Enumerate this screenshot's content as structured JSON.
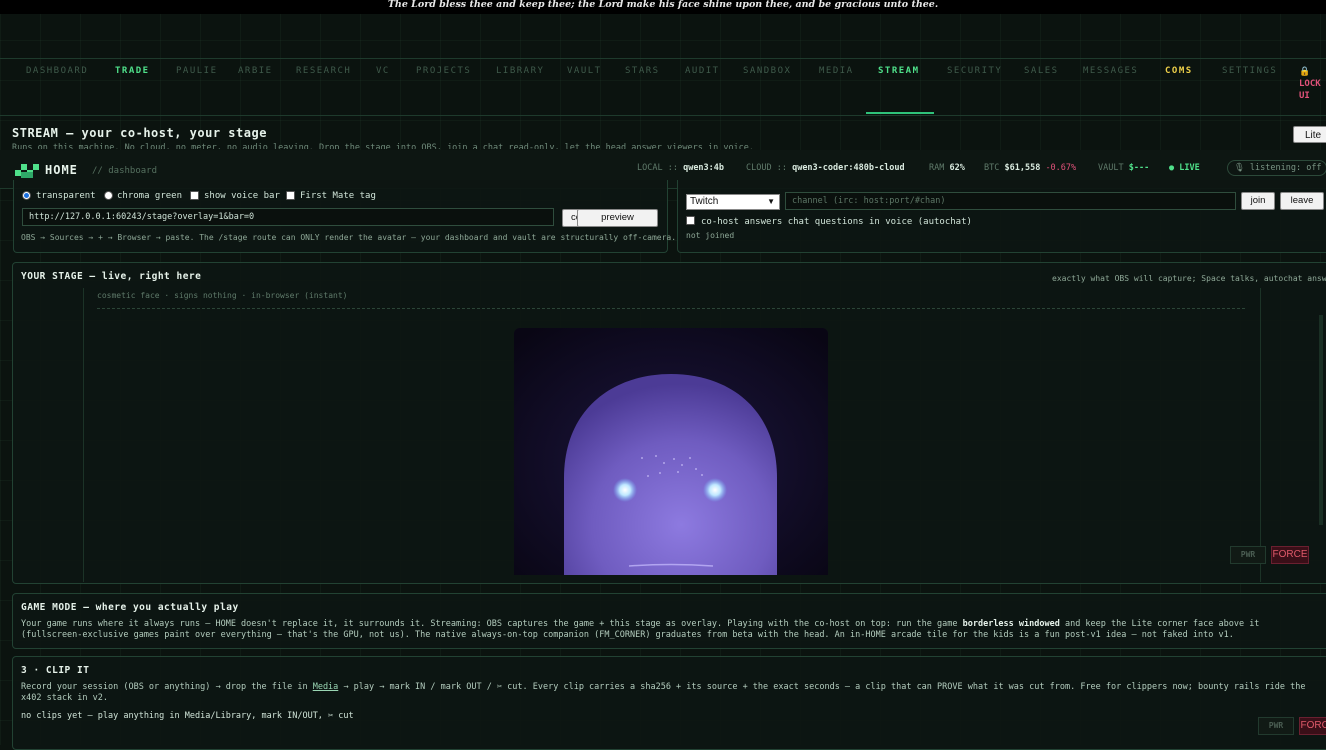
{
  "banner": "The Lord bless thee and keep thee; the Lord make his face shine upon thee, and be gracious unto thee.",
  "nav": {
    "items": [
      {
        "label": "DASHBOARD",
        "style": "dim"
      },
      {
        "label": "TRADE",
        "style": "green"
      },
      {
        "label": "PAULIE",
        "style": "dim"
      },
      {
        "label": "ARBIE",
        "style": "dim"
      },
      {
        "label": "RESEARCH",
        "style": "dim"
      },
      {
        "label": "VC",
        "style": "dim"
      },
      {
        "label": "PROJECTS",
        "style": "dim"
      },
      {
        "label": "LIBRARY",
        "style": "dim"
      },
      {
        "label": "VAULT",
        "style": "dim"
      },
      {
        "label": "STARS",
        "style": "dim"
      },
      {
        "label": "AUDIT",
        "style": "dim"
      },
      {
        "label": "SANDBOX",
        "style": "dim"
      },
      {
        "label": "MEDIA",
        "style": "dim"
      },
      {
        "label": "STREAM",
        "style": "green",
        "active": true
      },
      {
        "label": "SECURITY",
        "style": "dim"
      },
      {
        "label": "SALES",
        "style": "dim"
      },
      {
        "label": "MESSAGES",
        "style": "dim"
      },
      {
        "label": "COMS",
        "style": "yellow"
      },
      {
        "label": "SETTINGS",
        "style": "dim"
      }
    ],
    "lock_line1": "LOCK",
    "lock_line2": "UI",
    "lock_icon": "padlock-icon"
  },
  "stream": {
    "title": "STREAM — your co-host, your stage",
    "subtitle": "Runs on this machine. No cloud, no meter, no audio leaving. Drop the stage into OBS, join a chat read-only, let the head answer viewers in voice.",
    "lite_label": "Lite"
  },
  "home": {
    "title": "HOME",
    "crumb": "// dashboard",
    "local_label": "LOCAL ::",
    "local_value": "qwen3:4b",
    "cloud_label": "CLOUD ::",
    "cloud_value": "qwen3-coder:480b-cloud",
    "ram_label": "RAM",
    "ram_value": "62%",
    "btc_label": "BTC",
    "btc_value": "$61,558",
    "btc_change": "-0.67%",
    "vault_label": "VAULT",
    "vault_value": "$---",
    "live_label": "● LIVE",
    "listening": "🎙 listening: off"
  },
  "overlay": {
    "opt_transparent": "transparent",
    "opt_chroma": "chroma green",
    "opt_voicebar": "show voice bar",
    "opt_firstmate": "First Mate tag",
    "url": "http://127.0.0.1:60243/stage?overlay=1&bar=0",
    "copy_label": "copy",
    "preview_label": "preview",
    "hint": "OBS → Sources → + → Browser → paste. The /stage route can ONLY render the avatar — your dashboard and vault are structurally off-camera."
  },
  "chat": {
    "platform": "Twitch",
    "channel_placeholder": "channel  (irc: host:port/#chan)",
    "join_label": "join",
    "leave_label": "leave",
    "autochat_label": "co-host answers chat questions in voice (autochat)",
    "status": "not joined"
  },
  "stage": {
    "title": "YOUR STAGE — live, right here",
    "note": "exactly what OBS will capture; Space talks, autochat answers",
    "face_caption": "cosmetic face · signs nothing · in-browser (instant)",
    "pwr_label": "PWR",
    "force_label": "FORCE"
  },
  "game": {
    "title": "GAME MODE — where you actually play",
    "text_a": "Your game runs where it always runs — HOME doesn't replace it, it surrounds it. Streaming: OBS captures the game + this stage as overlay. Playing with the co-host on top: run the game ",
    "text_bold": "borderless windowed",
    "text_b": " and keep the Lite corner face above it (fullscreen-exclusive games paint over everything — that's the GPU, not us). The native always-on-top companion (FM_CORNER) graduates from beta with the head. An in-HOME arcade tile for the kids is a fun post-v1 idea — not faked into v1."
  },
  "clip": {
    "title": "3 · CLIP IT",
    "text_a": "Record your session (OBS or anything) → drop the file in ",
    "link": "Media",
    "text_b": " → play → mark IN / mark OUT / ✂ cut. Every clip carries a sha256 + its source + the exact seconds — a clip that can PROVE what it was cut from. Free for clippers now; bounty rails ride the x402 stack in v2.",
    "empty": "no clips yet — play anything in Media/Library, mark IN/OUT, ✂ cut",
    "pwr_label": "PWR",
    "force_label": "FORCE"
  },
  "colors": {
    "accent_green": "#4fe08a",
    "accent_yellow": "#f0d24a",
    "danger": "#e0527a",
    "face": "#7a66c8"
  }
}
